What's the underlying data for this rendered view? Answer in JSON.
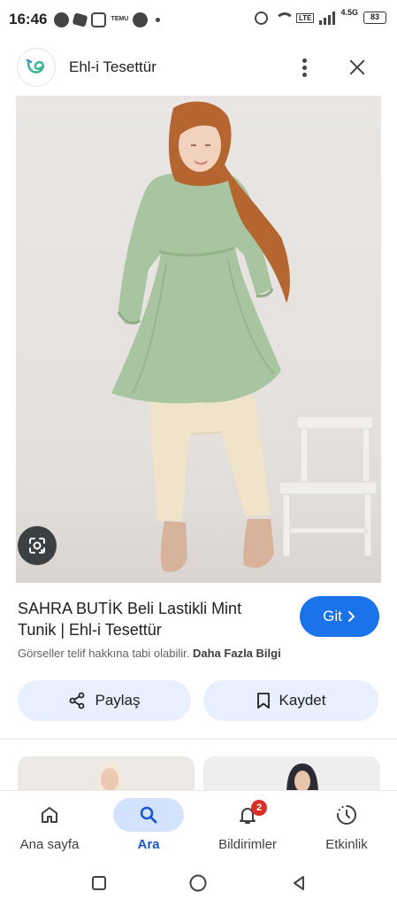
{
  "status_bar": {
    "time": "16:46",
    "temu_label": "TEMU",
    "network": "4.5G",
    "lte": "LTE",
    "battery": "83"
  },
  "header": {
    "site_title": "Ehl-i Tesettür",
    "logo_icon": "ehli-tesettur-logo",
    "menu_icon": "more-vert-icon",
    "close_icon": "close-icon"
  },
  "hero": {
    "lens_icon": "google-lens-icon"
  },
  "product": {
    "title": "SAHRA BUTİK Beli Lastikli Mint Tunik | Ehl-i Tesettür",
    "visit_label": "Git",
    "copyright_text": "Görseller telif hakkına tabi olabilir.",
    "more_info_label": "Daha Fazla Bilgi"
  },
  "actions": {
    "share_label": "Paylaş",
    "save_label": "Kaydet"
  },
  "bottom_nav": {
    "items": [
      {
        "label": "Ana sayfa",
        "icon": "home-icon",
        "active": false
      },
      {
        "label": "Ara",
        "icon": "search-icon",
        "active": true
      },
      {
        "label": "Bildirimler",
        "icon": "bell-icon",
        "active": false,
        "badge": "2"
      },
      {
        "label": "Etkinlik",
        "icon": "activity-icon",
        "active": false
      }
    ]
  },
  "colors": {
    "accent": "#1a73e8",
    "chip_bg": "#e8f0fe",
    "active_nav_bg": "#d3e3fd",
    "badge": "#d93025",
    "tunic": "#a8c4a0",
    "hijab": "#b5652f"
  }
}
